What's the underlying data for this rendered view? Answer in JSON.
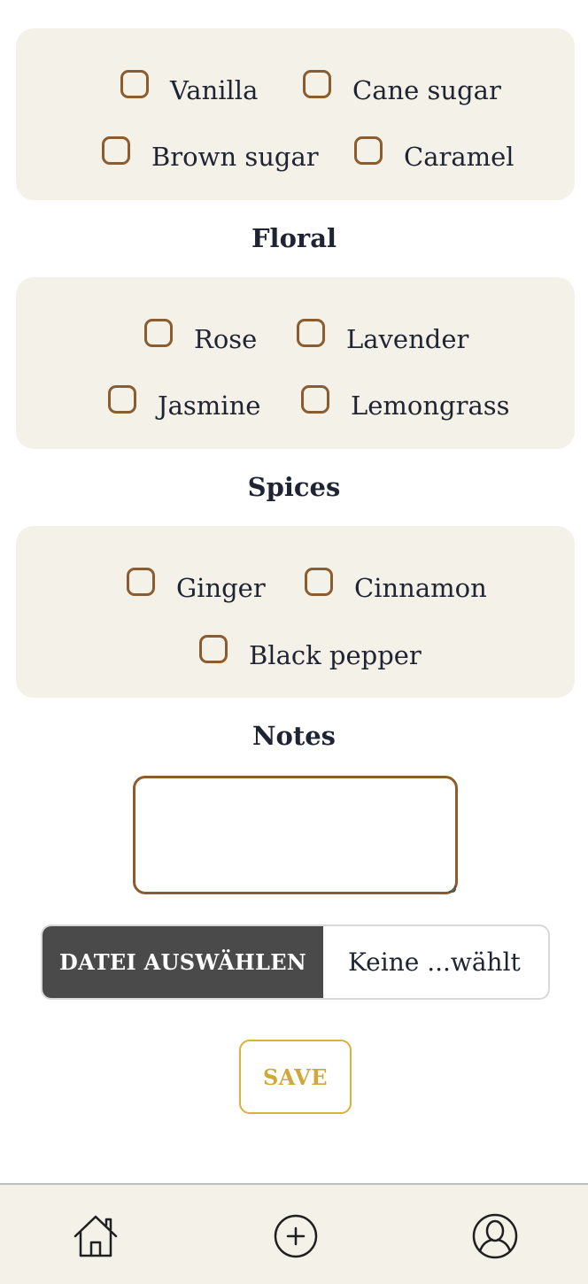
{
  "groups": [
    {
      "options": [
        {
          "label": "Vanilla",
          "checked": false
        },
        {
          "label": "Cane sugar",
          "checked": false
        },
        {
          "label": "Brown sugar",
          "checked": false
        },
        {
          "label": "Caramel",
          "checked": false
        }
      ]
    },
    {
      "title": "Floral",
      "options": [
        {
          "label": "Rose",
          "checked": false
        },
        {
          "label": "Lavender",
          "checked": false
        },
        {
          "label": "Jasmine",
          "checked": false
        },
        {
          "label": "Lemongrass",
          "checked": false
        }
      ]
    },
    {
      "title": "Spices",
      "options": [
        {
          "label": "Ginger",
          "checked": false
        },
        {
          "label": "Cinnamon",
          "checked": false
        },
        {
          "label": "Black pepper",
          "checked": false
        }
      ]
    }
  ],
  "notes": {
    "label": "Notes",
    "value": ""
  },
  "file": {
    "button_label": "DATEI AUSWÄHLEN",
    "status": "Keine ...wählt"
  },
  "save_label": "SAVE",
  "nav": {
    "items": [
      {
        "icon": "home-icon"
      },
      {
        "icon": "add-circle-icon"
      },
      {
        "icon": "profile-icon"
      }
    ]
  },
  "colors": {
    "card_bg": "#f4f1e8",
    "checkbox_border": "#8a5c2e",
    "file_button_bg": "#4a4a4a",
    "save_accent": "#d0a83a",
    "text": "#1f2433"
  }
}
